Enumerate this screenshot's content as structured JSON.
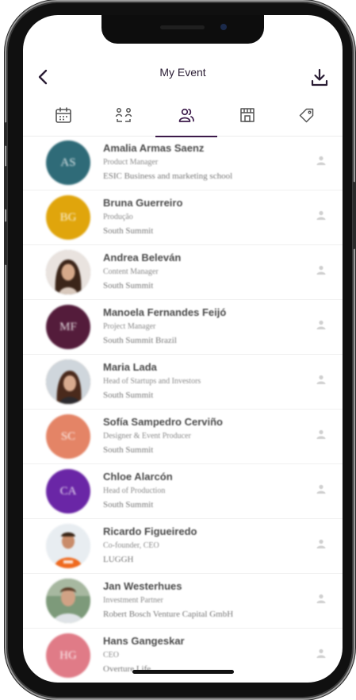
{
  "header": {
    "title": "My Event"
  },
  "tabs": [
    {
      "icon": "calendar-icon",
      "active": false
    },
    {
      "icon": "network-icon",
      "active": false
    },
    {
      "icon": "people-icon",
      "active": true
    },
    {
      "icon": "store-icon",
      "active": false
    },
    {
      "icon": "tag-icon",
      "active": false
    }
  ],
  "people": [
    {
      "initials": "AS",
      "color": "#2f6b78",
      "name": "Amalia Armas Saenz",
      "role": "Product Manager",
      "company": "ESIC Business and marketing school"
    },
    {
      "initials": "BG",
      "color": "#e0a50c",
      "name": "Bruna Guerreiro",
      "role": "Produção",
      "company": "South Summit"
    },
    {
      "initials": "",
      "color": "#7a5a44",
      "name": "Andrea Beleván",
      "role": "Content Manager",
      "company": "South Summit"
    },
    {
      "initials": "MF",
      "color": "#541c3b",
      "name": "Manoela Fernandes Feijó",
      "role": "Project Manager",
      "company": "South Summit Brazil"
    },
    {
      "initials": "",
      "color": "#6b4a3a",
      "name": "Maria Lada",
      "role": "Head of Startups and Investors",
      "company": "South Summit"
    },
    {
      "initials": "SC",
      "color": "#e48466",
      "name": "Sofía Sampedro Cerviño",
      "role": "Designer & Event Producer",
      "company": "South Summit"
    },
    {
      "initials": "CA",
      "color": "#6a26a6",
      "name": "Chloe Alarcón",
      "role": "Head of Production",
      "company": "South Summit"
    },
    {
      "initials": "",
      "color": "#d9dfe6",
      "name": "Ricardo Figueiredo",
      "role": "Co-founder, CEO",
      "company": "LUGGH"
    },
    {
      "initials": "",
      "color": "#93a88a",
      "name": "Jan Westerhues",
      "role": "Investment Partner",
      "company": "Robert Bosch Venture Capital GmbH"
    },
    {
      "initials": "HG",
      "color": "#e07b87",
      "name": "Hans Gangeskar",
      "role": "CEO",
      "company": "Overture Life"
    }
  ]
}
